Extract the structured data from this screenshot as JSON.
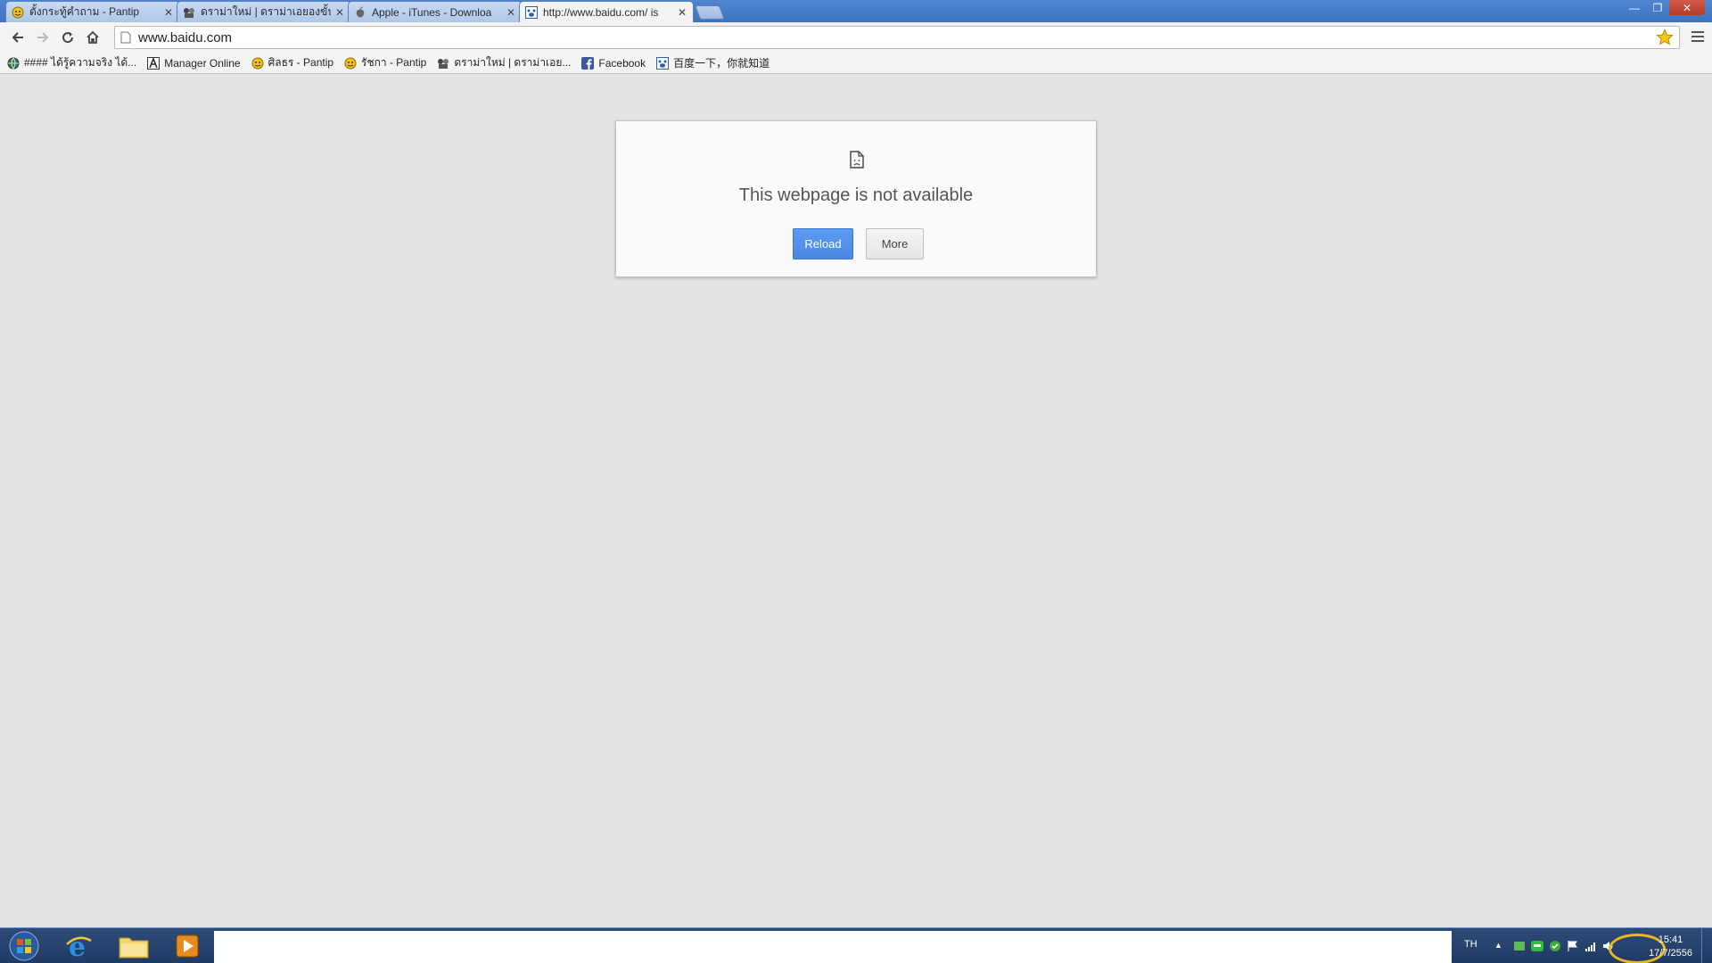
{
  "browser": {
    "tabs": [
      {
        "title": "ตั้งกระทู้คำถาม - Pantip",
        "favicon": "pantip-smiley-icon",
        "active": false
      },
      {
        "title": "ดราม่าใหม่ | ดราม่าเอยองขั้นเ",
        "favicon": "drama-icon",
        "active": false
      },
      {
        "title": "Apple - iTunes - Downloa",
        "favicon": "apple-icon",
        "active": false
      },
      {
        "title": "http://www.baidu.com/ is",
        "favicon": "baidu-paw-icon",
        "active": true
      }
    ],
    "address": "www.baidu.com",
    "bookmarks": [
      {
        "label": "#### ได้รู้ความจริง ได้...",
        "icon": "globe-icon"
      },
      {
        "label": "Manager Online",
        "icon": "manager-icon"
      },
      {
        "label": "ศิลธร - Pantip",
        "icon": "pantip-smiley-icon"
      },
      {
        "label": "รัชกา - Pantip",
        "icon": "pantip-smiley-icon"
      },
      {
        "label": "ดราม่าใหม่ | ดราม่าเอย...",
        "icon": "drama-icon"
      },
      {
        "label": "Facebook",
        "icon": "facebook-icon"
      },
      {
        "label": "百度一下，你就知道",
        "icon": "baidu-paw-icon"
      }
    ]
  },
  "error_page": {
    "heading": "This webpage is not available",
    "reload_label": "Reload",
    "more_label": "More"
  },
  "taskbar": {
    "language": "TH",
    "time": "15:41",
    "date": "17/7/2556"
  },
  "colors": {
    "accent_blue": "#4a87e2",
    "highlight_ring": "#e8b820",
    "taskbar": "#1f3a63"
  }
}
